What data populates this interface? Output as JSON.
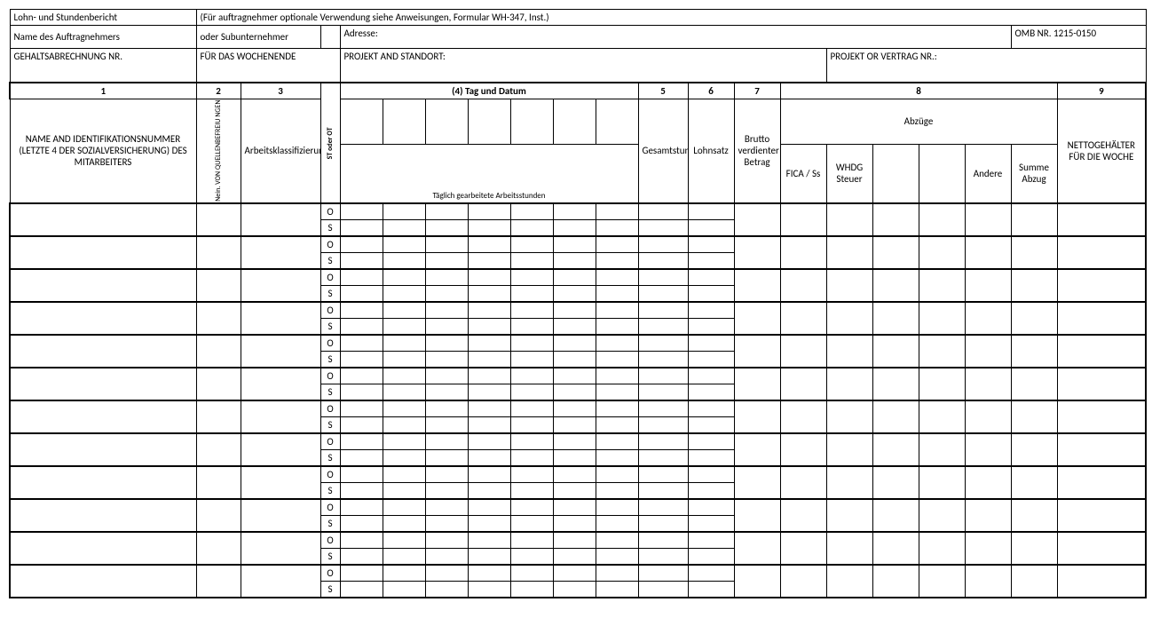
{
  "top": {
    "title": "Lohn- und Stundenbericht",
    "instruction": "(Für auftragnehmer optionale Verwendung siehe Anweisungen, Formular WH-347, Inst.)"
  },
  "contractor": {
    "name_label": "Name des Auftragnehmers",
    "sub_label": "oder Subunternehmer",
    "address_label": "Adresse:",
    "omb_label": "OMB NR. 1215-0150"
  },
  "payroll": {
    "no_label": "GEHALTSABRECHNUNG NR.",
    "weekending_label": "FÜR DAS WOCHENENDE",
    "project_label": "PROJEKT AND STANDORT:",
    "contract_label": "PROJEKT OR VERTRAG NR.:"
  },
  "cols": {
    "c1": "1",
    "c2": "2",
    "c3": "3",
    "c4": "(4) Tag und Datum",
    "c5": "5",
    "c6": "6",
    "c7": "7",
    "c8": "8",
    "c9": "9"
  },
  "sub": {
    "name": "NAME AND IDENTIFIKATIONSNUMMER (LETZTE 4 DER SOZIALVERSICHERUNG) DES MITARBEITERS",
    "exempt": "Nein. VON QUELLENBEFREIU NGEN",
    "classification": "Arbeitsklassifizierung",
    "ot": "ST oder OT",
    "daily": "Täglich gearbeitete Arbeitsstunden",
    "total": "Gesamtstunden",
    "rate": "Lohnsatz",
    "gross": "Brutto verdienter Betrag",
    "deductions": "Abzüge",
    "fica": "FICA / Ss",
    "whdg": "WHDG Steuer",
    "other": "Andere",
    "sum": "Summe Abzug",
    "net": "NETTOGEHÄLTER FÜR DIE WOCHE"
  },
  "ot_codes": {
    "o": "O",
    "s": "S"
  },
  "row_count": 12
}
